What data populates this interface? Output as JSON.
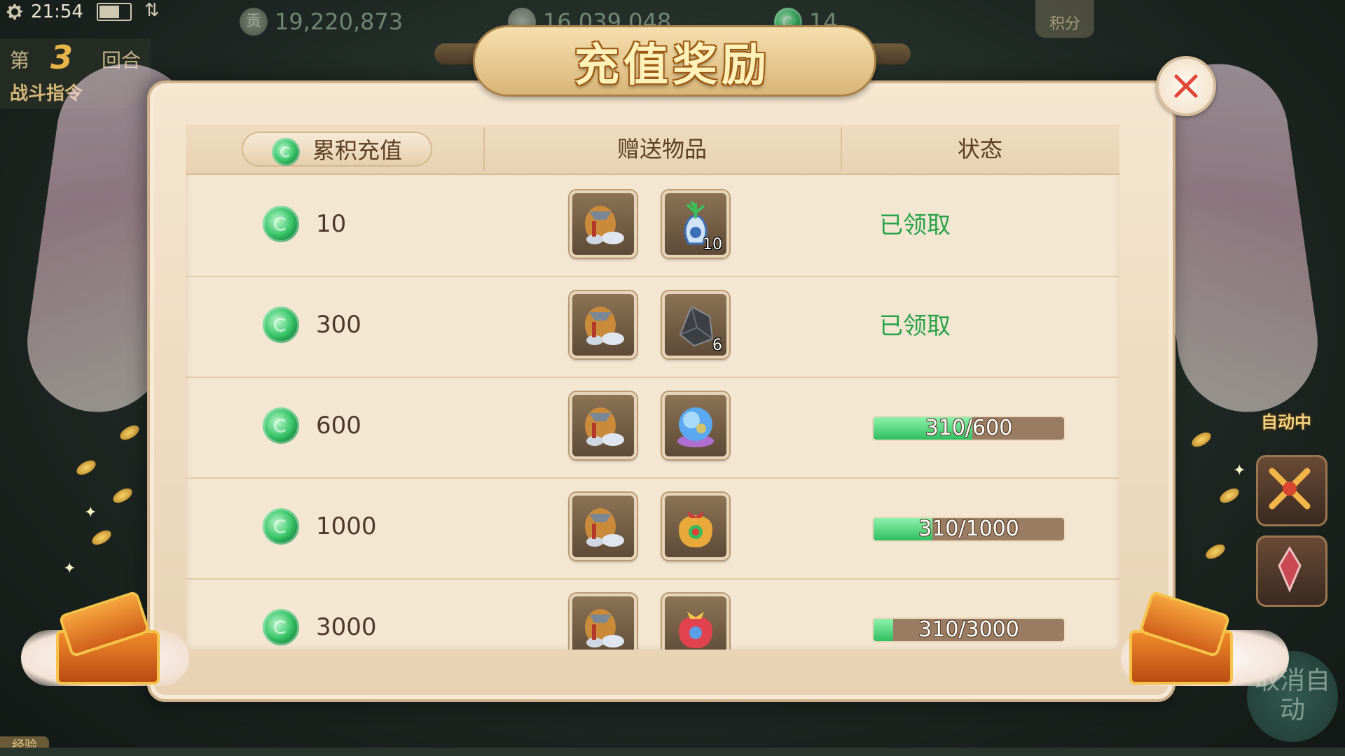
{
  "hud": {
    "time": "21:54",
    "gold": "19,220,873",
    "gold_badge": "贡",
    "silver": "16,039,048",
    "jade": "14",
    "round_prefix": "第",
    "round_number": "3",
    "round_suffix": "回合",
    "battle_command": "战斗指令",
    "score_label": "积分",
    "auto_label": "自动中",
    "cancel_auto": "取消自动",
    "exp_label": "经验"
  },
  "dialog": {
    "title": "充值奖励",
    "columns": {
      "cumulative": "累积充值",
      "gifts": "赠送物品",
      "status": "状态"
    },
    "rows": [
      {
        "amount": "10",
        "items": [
          {
            "icon": "silver-bag-icon",
            "count": ""
          },
          {
            "icon": "herb-vase-icon",
            "count": "10"
          }
        ],
        "status": "已领取",
        "claimed": true
      },
      {
        "amount": "300",
        "items": [
          {
            "icon": "silver-bag-icon",
            "count": ""
          },
          {
            "icon": "black-ore-icon",
            "count": "6"
          }
        ],
        "status": "已领取",
        "claimed": true
      },
      {
        "amount": "600",
        "items": [
          {
            "icon": "silver-bag-icon",
            "count": ""
          },
          {
            "icon": "crystal-orb-icon",
            "count": ""
          }
        ],
        "status": "310/600",
        "claimed": false,
        "progress": 0.517
      },
      {
        "amount": "1000",
        "items": [
          {
            "icon": "silver-bag-icon",
            "count": ""
          },
          {
            "icon": "gift-pouch-icon",
            "count": ""
          }
        ],
        "status": "310/1000",
        "claimed": false,
        "progress": 0.31
      },
      {
        "amount": "3000",
        "items": [
          {
            "icon": "silver-bag-icon",
            "count": ""
          },
          {
            "icon": "red-pouch-icon",
            "count": ""
          }
        ],
        "status": "310/3000",
        "claimed": false,
        "progress": 0.103
      }
    ]
  },
  "colors": {
    "claimed_text": "#27a24a",
    "progress_fill": "#2fbe60",
    "progress_track": "#9a7c62",
    "close_x": "#e0463a",
    "panel_bg": "#f4e7d2"
  }
}
